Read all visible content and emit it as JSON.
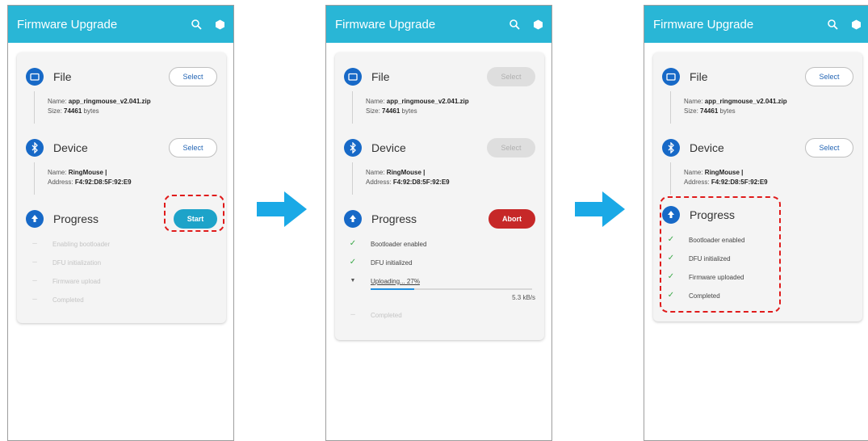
{
  "screens": [
    {
      "title": "Firmware Upgrade",
      "file": {
        "label": "File",
        "button": "Select",
        "name_label": "Name:",
        "name_value": "app_ringmouse_v2.041.zip",
        "size_label": "Size:",
        "size_value": "74461",
        "size_unit": "bytes"
      },
      "device": {
        "label": "Device",
        "button": "Select",
        "name_label": "Name:",
        "name_value": "RingMouse |",
        "address_label": "Address:",
        "address_value": "F4:92:D8:5F:92:E9"
      },
      "progress": {
        "label": "Progress",
        "button": "Start",
        "steps": [
          "Enabling bootloader",
          "DFU initialization",
          "Firmware upload",
          "Completed"
        ]
      }
    },
    {
      "title": "Firmware Upgrade",
      "file": {
        "label": "File",
        "button": "Select",
        "name_label": "Name:",
        "name_value": "app_ringmouse_v2.041.zip",
        "size_label": "Size:",
        "size_value": "74461",
        "size_unit": "bytes"
      },
      "device": {
        "label": "Device",
        "button": "Select",
        "name_label": "Name:",
        "name_value": "RingMouse |",
        "address_label": "Address:",
        "address_value": "F4:92:D8:5F:92:E9"
      },
      "progress": {
        "label": "Progress",
        "button": "Abort",
        "steps": [
          "Bootloader enabled",
          "DFU initialized",
          "Uploading... 27%",
          "Completed"
        ],
        "upload_fraction": 0.27,
        "speed": "5.3 kB/s"
      }
    },
    {
      "title": "Firmware Upgrade",
      "file": {
        "label": "File",
        "button": "Select",
        "name_label": "Name:",
        "name_value": "app_ringmouse_v2.041.zip",
        "size_label": "Size:",
        "size_value": "74461",
        "size_unit": "bytes"
      },
      "device": {
        "label": "Device",
        "button": "Select",
        "name_label": "Name:",
        "name_value": "RingMouse |",
        "address_label": "Address:",
        "address_value": "F4:92:D8:5F:92:E9"
      },
      "progress": {
        "label": "Progress",
        "steps": [
          "Bootloader enabled",
          "DFU initialized",
          "Firmware uploaded",
          "Completed"
        ]
      }
    }
  ],
  "colors": {
    "appbar": "#29b6d6",
    "section_icon": "#1769c7",
    "start": "#1da3c9",
    "abort": "#c62828",
    "check": "#3aa848",
    "highlight": "#e01b1b",
    "arrow": "#1aa9e6"
  },
  "icons": {
    "search": "search-icon",
    "settings": "settings-icon",
    "file": "folder-icon",
    "device": "bluetooth-icon",
    "progress": "upload-icon",
    "check": "check-icon",
    "arrow": "arrow-right-icon"
  }
}
